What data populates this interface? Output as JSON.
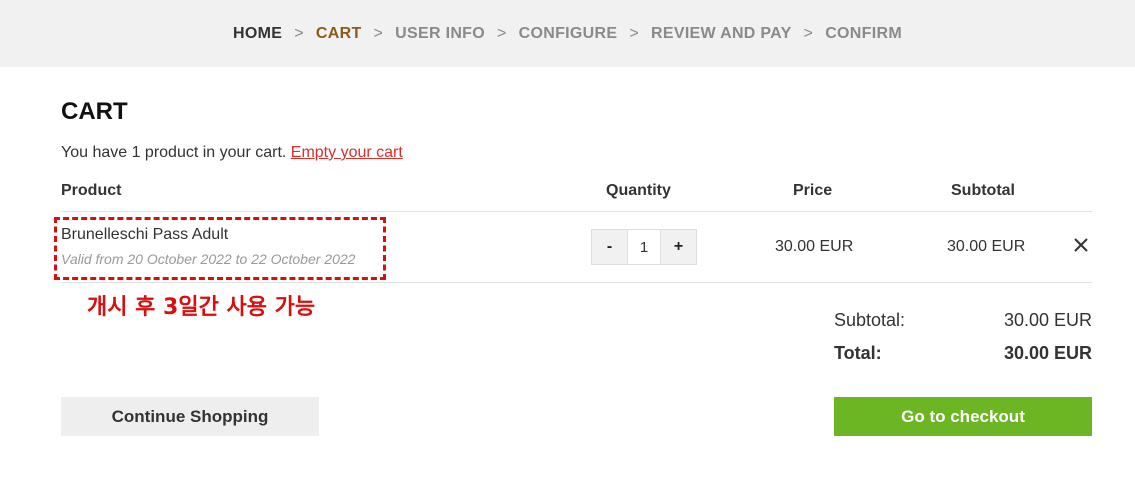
{
  "breadcrumb": {
    "steps": [
      "HOME",
      "CART",
      "USER INFO",
      "CONFIGURE",
      "REVIEW AND PAY",
      "CONFIRM"
    ],
    "separator": ">",
    "active_step": "CART"
  },
  "cart": {
    "title": "CART",
    "info_text": "You have 1 product in your cart.",
    "empty_link": "Empty your cart",
    "columns": {
      "product": "Product",
      "quantity": "Quantity",
      "price": "Price",
      "subtotal": "Subtotal"
    },
    "items": [
      {
        "name": "Brunelleschi Pass Adult",
        "valid": "Valid from 20 October 2022 to 22 October 2022",
        "quantity": "1",
        "decrement_label": "-",
        "increment_label": "+",
        "price": "30.00 EUR",
        "subtotal": "30.00 EUR",
        "remove_icon": "close-icon"
      }
    ],
    "annotation": "개시 후 3일간 사용 가능",
    "summary": {
      "subtotal_label": "Subtotal:",
      "subtotal_value": "30.00 EUR",
      "total_label": "Total:",
      "total_value": "30.00 EUR"
    }
  },
  "actions": {
    "continue_label": "Continue Shopping",
    "checkout_label": "Go to checkout"
  },
  "colors": {
    "active_step": "#8b5a1c",
    "link": "#d9302a",
    "annotation": "#d60f0f",
    "checkout": "#6cb523"
  }
}
